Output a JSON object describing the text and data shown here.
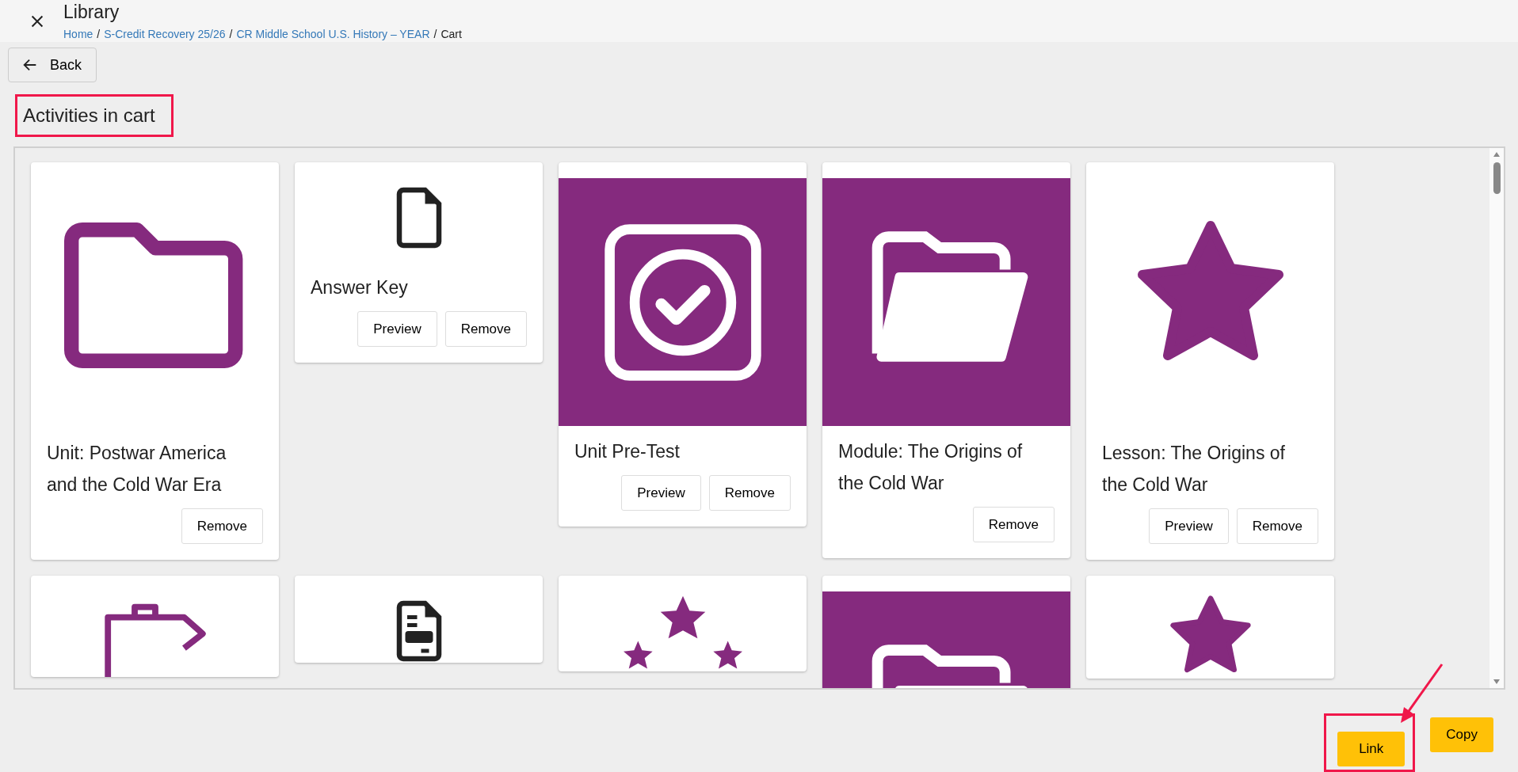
{
  "header": {
    "title": "Library",
    "separator": "/",
    "breadcrumb": [
      {
        "label": "Home",
        "link": true
      },
      {
        "label": "S-Credit Recovery 25/26",
        "link": true
      },
      {
        "label": "CR Middle School U.S. History – YEAR",
        "link": true
      },
      {
        "label": "Cart",
        "link": false
      }
    ]
  },
  "back_button": "Back",
  "heading": {
    "text": "Activities in cart",
    "highlighted": true
  },
  "cards": [
    {
      "kind": "large",
      "title": "Unit: Postwar America and the Cold War Era",
      "buttons": [
        "Remove"
      ]
    },
    {
      "kind": "small",
      "title": "Answer Key",
      "buttons": [
        "Preview",
        "Remove"
      ]
    },
    {
      "kind": "banner",
      "title": "Unit Pre-Test",
      "buttons": [
        "Preview",
        "Remove"
      ]
    },
    {
      "kind": "banner",
      "title": "Module: The Origins of the Cold War",
      "buttons": [
        "Remove"
      ]
    },
    {
      "kind": "large",
      "title": "Lesson: The Origins of the Cold War",
      "buttons": [
        "Preview",
        "Remove"
      ]
    },
    {
      "kind": "large"
    },
    {
      "kind": "small"
    },
    {
      "kind": "large"
    },
    {
      "kind": "banner"
    },
    {
      "kind": "large"
    }
  ],
  "footer_buttons": [
    {
      "label": "Link",
      "highlighted": true
    },
    {
      "label": "Copy",
      "highlighted": false
    }
  ]
}
